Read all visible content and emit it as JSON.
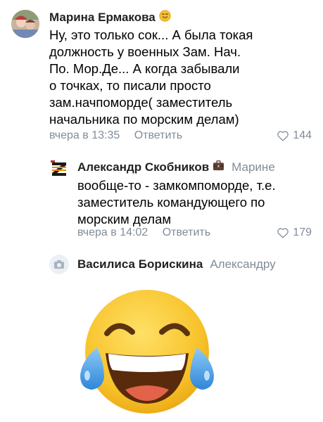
{
  "comments": [
    {
      "author": "Марина Ермакова",
      "text": "Ну, это только сок... А была токая должность у военных Зам. Нач. По. Мор.Де... А когда забывали о точках, то писали просто зам.начпоморде( заместитель начальника по морским делам)",
      "lines": [
        "Ну, это только сок... А была токая",
        "должность у военных Зам. Нач.",
        "По. Мор.Де... А когда забывали",
        "о точках, то писали просто",
        "зам.начпоморде( заместитель",
        "начальника по морским делам)"
      ],
      "time": "вчера в 13:35",
      "reply_label": "Ответить",
      "likes": "144"
    },
    {
      "author": "Александр Скобников",
      "reply_to": "Марине",
      "lines": [
        "вообще-то - замкомпоморде, т.е.",
        "заместитель командующего по",
        "морским делам"
      ],
      "time": "вчера в 14:02",
      "reply_label": "Ответить",
      "likes": "179"
    },
    {
      "author": "Василиса Борискина",
      "reply_to": "Александру"
    }
  ],
  "colors": {
    "meta": "#818c99",
    "reply": "#818c99",
    "text": "#000000",
    "emoji_face": "#f7c22a",
    "emoji_tear": "#4ea4e8"
  },
  "icons": [
    "heart-icon",
    "camera-icon",
    "briefcase-icon",
    "smiling-emoji-icon",
    "laughing-tears-emoji"
  ]
}
